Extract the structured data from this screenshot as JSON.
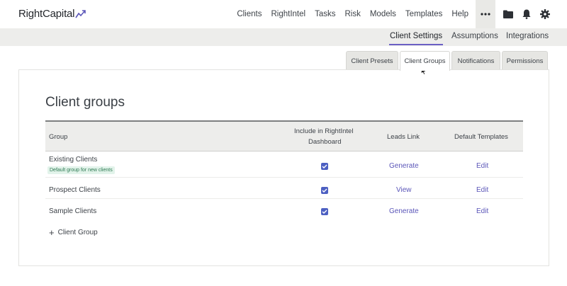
{
  "brand": {
    "name": "RightCapital"
  },
  "nav": {
    "items": [
      "Clients",
      "RightIntel",
      "Tasks",
      "Risk",
      "Models",
      "Templates",
      "Help"
    ]
  },
  "icons": [
    "more-icon",
    "folder-icon",
    "bell-icon",
    "gear-icon"
  ],
  "subnav": {
    "items": [
      "Client Settings",
      "Assumptions",
      "Integrations"
    ],
    "active": "Client Settings"
  },
  "tabs": {
    "items": [
      "Client Presets",
      "Client Groups",
      "Notifications",
      "Permissions"
    ],
    "active": "Client Groups"
  },
  "page": {
    "title": "Client groups"
  },
  "table": {
    "headers": {
      "group": "Group",
      "include_line1": "Include in RightIntel",
      "include_line2": "Dashboard",
      "leads": "Leads Link",
      "templates": "Default Templates"
    },
    "rows": [
      {
        "group": "Existing Clients",
        "badge": "Default group for new clients",
        "included": true,
        "leads": "Generate",
        "templates": "Edit"
      },
      {
        "group": "Prospect Clients",
        "badge": "",
        "included": true,
        "leads": "View",
        "templates": "Edit"
      },
      {
        "group": "Sample Clients",
        "badge": "",
        "included": true,
        "leads": "Generate",
        "templates": "Edit"
      }
    ]
  },
  "add_group": {
    "label": "Client Group"
  },
  "colors": {
    "accent": "#6a5fc4",
    "checkbox": "#4d60c2",
    "link": "#5a55b8",
    "badge_bg": "#e2f3ea",
    "badge_text": "#2e7a53"
  }
}
